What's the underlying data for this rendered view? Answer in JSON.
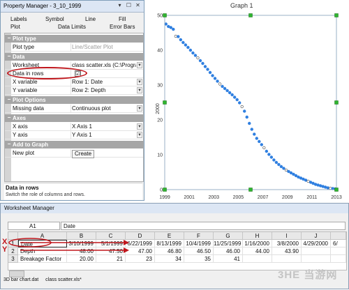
{
  "property_manager": {
    "title": "Property Manager - 3_10_1999",
    "win_buttons": [
      "▾",
      "☐",
      "✕"
    ],
    "tabs_row1": [
      "Labels",
      "Symbol",
      "Line",
      "Fill"
    ],
    "tabs_row2": [
      "Plot",
      "Data Limits",
      "Error Bars"
    ],
    "sections": {
      "plot_type": {
        "label": "Plot type",
        "toggle": "−"
      },
      "data": {
        "label": "Data",
        "toggle": "−"
      },
      "plot_options": {
        "label": "Plot Options",
        "toggle": "−"
      },
      "axes": {
        "label": "Axes",
        "toggle": "−"
      },
      "add_to_graph": {
        "label": "Add to Graph",
        "toggle": "−"
      }
    },
    "rows": {
      "plot_type": {
        "key": "Plot type",
        "value": "Line/Scatter Plot"
      },
      "worksheet": {
        "key": "Worksheet",
        "value": "class scatter.xls (C:\\Progra..."
      },
      "data_in_rows": {
        "key": "Data in rows",
        "checked": "☑"
      },
      "x_variable": {
        "key": "X variable",
        "value": "Row 1: Date"
      },
      "y_variable": {
        "key": "Y variable",
        "value": "Row 2: Depth"
      },
      "missing_data": {
        "key": "Missing data",
        "value": "Continuous plot"
      },
      "x_axis": {
        "key": "X axis",
        "value": "X Axis 1"
      },
      "y_axis": {
        "key": "Y axis",
        "value": "Y Axis 1"
      },
      "new_plot": {
        "key": "New plot",
        "button": "Create"
      }
    },
    "help_title": "Data in rows",
    "help_text": "Switch the role of columns and rows.",
    "highlight_color": "#c0161c"
  },
  "graph": {
    "title": "Graph 1",
    "ylabel": "2000"
  },
  "chart_data": {
    "type": "scatter",
    "title": "Graph 1",
    "xlabel": "",
    "ylabel": "2000",
    "x_ticks": [
      "1999",
      "2001",
      "2003",
      "2005",
      "2007",
      "2009",
      "2011",
      "2013"
    ],
    "y_ticks": [
      "0",
      "10",
      "20",
      "30",
      "40",
      "50"
    ],
    "xlim": [
      1999,
      2013
    ],
    "ylim": [
      0,
      50
    ],
    "grid": false,
    "series": [
      {
        "color": "#2f7fe0",
        "x": [
          1999.1,
          1999.3,
          1999.5,
          1999.7,
          1999.9,
          2000.1,
          2000.3,
          2000.5,
          2000.7,
          2000.9,
          2001.1,
          2001.3,
          2001.5,
          2001.7,
          2001.9,
          2002.1,
          2002.3,
          2002.5,
          2002.7,
          2002.9,
          2003.1,
          2003.3,
          2003.5,
          2003.7,
          2003.9,
          2004.1,
          2004.3,
          2004.5,
          2004.7,
          2004.9,
          2005.1,
          2005.3,
          2005.5,
          2005.7,
          2005.9,
          2006.1,
          2006.3,
          2006.5,
          2006.7,
          2006.9,
          2007.1,
          2007.3,
          2007.5,
          2007.7,
          2007.9,
          2008.1,
          2008.3,
          2008.5,
          2008.7,
          2008.9,
          2009.1,
          2009.3,
          2009.5,
          2009.7,
          2009.9,
          2010.1,
          2010.3,
          2010.5,
          2010.7,
          2010.9,
          2011.1,
          2011.3,
          2011.5,
          2011.7,
          2011.9,
          2012.1,
          2012.3,
          2012.5,
          2012.7,
          2012.9
        ],
        "y": [
          47.5,
          46.8,
          46.5,
          46.0,
          44.0,
          43.9,
          43.0,
          42.2,
          41.5,
          40.8,
          40.0,
          39.2,
          38.5,
          37.8,
          37.0,
          36.2,
          35.3,
          34.5,
          33.6,
          32.7,
          31.9,
          31.1,
          30.3,
          29.6,
          29.0,
          28.4,
          27.8,
          27.2,
          26.5,
          25.8,
          24.9,
          23.8,
          22.5,
          20.8,
          19.0,
          17.3,
          15.9,
          14.7,
          13.8,
          12.9,
          12.0,
          11.0,
          10.1,
          9.3,
          8.5,
          7.8,
          7.2,
          6.6,
          6.1,
          5.6,
          5.2,
          4.8,
          4.4,
          4.0,
          3.6,
          3.3,
          3.0,
          2.7,
          2.4,
          2.1,
          1.8,
          1.5,
          1.3,
          1.1,
          0.9,
          0.7,
          0.5,
          0.4,
          0.3,
          0.2
        ]
      }
    ]
  },
  "worksheet_manager": {
    "title": "Worksheet Manager",
    "cell_ref": "A1",
    "cell_value": "Date",
    "columns": [
      "A",
      "B",
      "C",
      "D",
      "E",
      "F",
      "G",
      "H",
      "I",
      "J"
    ],
    "rows": [
      {
        "num": "1",
        "cells": [
          "Date",
          "3/10/1999",
          "5/1/1999",
          "6/22/1999",
          "8/13/1999",
          "10/4/1999",
          "11/25/1999",
          "1/16/2000",
          "3/8/2000",
          "4/29/2000",
          "6/"
        ]
      },
      {
        "num": "2",
        "cells": [
          "Depth",
          "48.00",
          "47.50",
          "47.00",
          "46.80",
          "46.50",
          "46.00",
          "44.00",
          "43.90",
          "",
          ""
        ]
      },
      {
        "num": "3",
        "cells": [
          "Breakage Factor",
          "20.00",
          "21",
          "23",
          "34",
          "35",
          "41",
          "",
          "",
          "",
          ""
        ]
      }
    ],
    "row_marks": [
      "X",
      "Y"
    ],
    "sheet_tabs": [
      "3D bar chart.dat",
      "class scatter.xls*"
    ]
  },
  "watermark": "3HE 当游网"
}
